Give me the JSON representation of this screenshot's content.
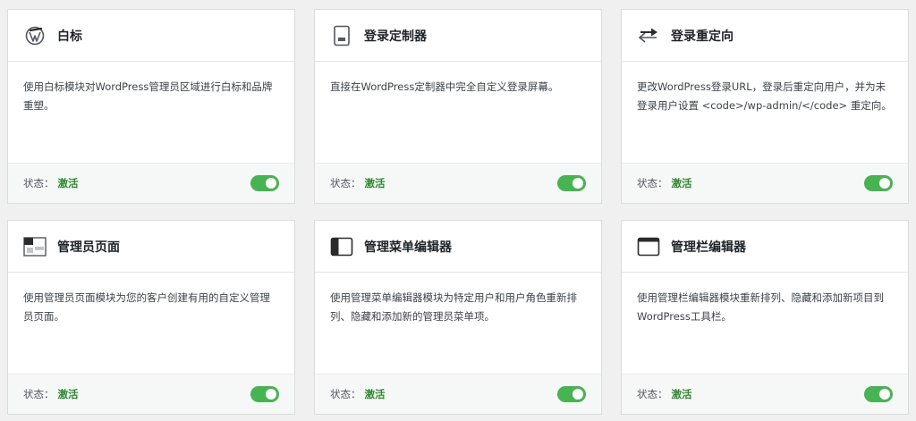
{
  "status_label": "状态：",
  "accent_color": "#46b450",
  "cards": [
    {
      "icon": "wordpress-icon",
      "title": "白标",
      "description": "使用白标模块对WordPress管理员区域进行白标和品牌重塑。",
      "status": "激活",
      "enabled": true
    },
    {
      "icon": "login-page-icon",
      "title": "登录定制器",
      "description": "直接在WordPress定制器中完全自定义登录屏幕。",
      "status": "激活",
      "enabled": true
    },
    {
      "icon": "redirect-arrows-icon",
      "title": "登录重定向",
      "description": "更改WordPress登录URL，登录后重定向用户，并为未登录用户设置 <code>/wp-admin/</code> 重定向。",
      "status": "激活",
      "enabled": true
    },
    {
      "icon": "admin-page-icon",
      "title": "管理员页面",
      "description": "使用管理员页面模块为您的客户创建有用的自定义管理员页面。",
      "status": "激活",
      "enabled": true
    },
    {
      "icon": "sidebar-menu-icon",
      "title": "管理菜单编辑器",
      "description": "使用管理菜单编辑器模块为特定用户和用户角色重新排列、隐藏和添加新的管理员菜单项。",
      "status": "激活",
      "enabled": true
    },
    {
      "icon": "toolbar-icon",
      "title": "管理栏编辑器",
      "description": "使用管理栏编辑器模块重新排列、隐藏和添加新项目到WordPress工具栏。",
      "status": "激活",
      "enabled": true
    }
  ]
}
